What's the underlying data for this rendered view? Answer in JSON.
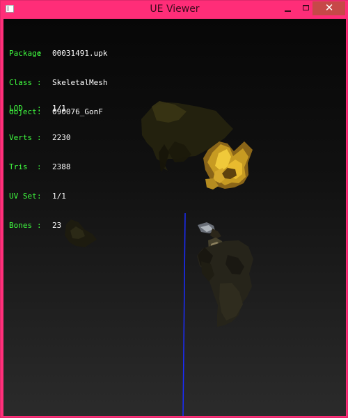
{
  "window": {
    "title": "UE Viewer",
    "minimize_glyph": "minimize-icon",
    "maximize_glyph": "maximize-icon",
    "close_glyph": "✕"
  },
  "info": {
    "separator": ":",
    "top": [
      {
        "label": "Package",
        "value": "00031491.upk"
      },
      {
        "label": "Class",
        "value": "SkeletalMesh"
      },
      {
        "label": "Object",
        "value": "090076_GonF"
      }
    ],
    "stats": [
      {
        "label": "LOD",
        "value": "1/1"
      },
      {
        "label": "Verts",
        "value": "2230"
      },
      {
        "label": "Tris",
        "value": "2388"
      },
      {
        "label": "UV Set",
        "value": "1/1"
      },
      {
        "label": "Bones",
        "value": "23"
      }
    ]
  },
  "colors": {
    "title_bar": "#ff2d78",
    "close_button": "#c74848",
    "info_label": "#40ff40",
    "info_value": "#ffffff",
    "axis_line": "#1a2cff"
  }
}
